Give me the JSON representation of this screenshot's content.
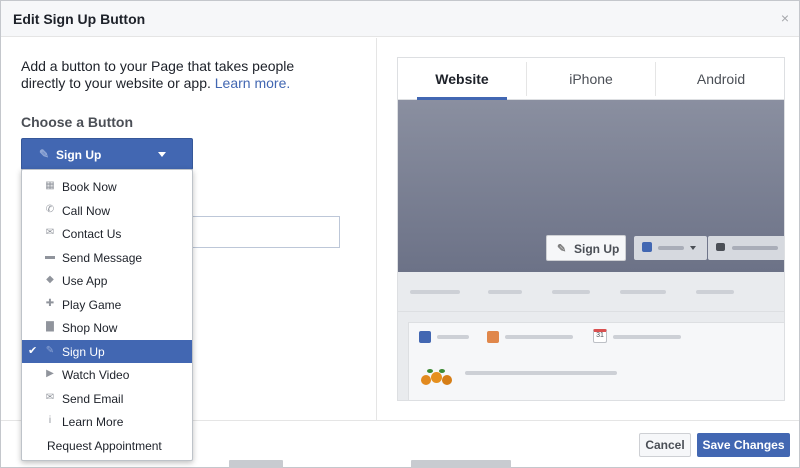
{
  "dialog": {
    "title": "Edit Sign Up Button",
    "close_glyph": "×"
  },
  "intro": {
    "text": "Add a button to your Page that takes people directly to your website or app.",
    "link": "Learn more."
  },
  "choose_label": "Choose a Button",
  "dropdown": {
    "selected": "Sign Up",
    "icon": "pencil-icon"
  },
  "menu": {
    "items": [
      {
        "label": "Book Now",
        "icon": "calendar-icon",
        "glyph": "▦"
      },
      {
        "label": "Call Now",
        "icon": "phone-icon",
        "glyph": "✆"
      },
      {
        "label": "Contact Us",
        "icon": "envelope-icon",
        "glyph": "✉"
      },
      {
        "label": "Send Message",
        "icon": "chat-icon",
        "glyph": "▬"
      },
      {
        "label": "Use App",
        "icon": "cube-icon",
        "glyph": "◆"
      },
      {
        "label": "Play Game",
        "icon": "gamepad-icon",
        "glyph": "✚"
      },
      {
        "label": "Shop Now",
        "icon": "bag-icon",
        "glyph": "▇"
      },
      {
        "label": "Sign Up",
        "icon": "pencil-icon",
        "glyph": "✎",
        "selected": true
      },
      {
        "label": "Watch Video",
        "icon": "play-icon",
        "glyph": "▶"
      },
      {
        "label": "Send Email",
        "icon": "envelope-icon",
        "glyph": "✉"
      },
      {
        "label": "Learn More",
        "icon": "info-icon",
        "glyph": "i"
      },
      {
        "label": "Request Appointment",
        "icon": "",
        "glyph": ""
      }
    ],
    "check_glyph": "✔"
  },
  "preview": {
    "tabs": [
      "Website",
      "iPhone",
      "Android"
    ],
    "active_tab": "Website",
    "button_label": "Sign Up",
    "calendar_day": "31"
  },
  "footer": {
    "cancel": "Cancel",
    "save": "Save Changes"
  },
  "colors": {
    "accent": "#4267b2",
    "header_bg": "#f6f7f9"
  }
}
